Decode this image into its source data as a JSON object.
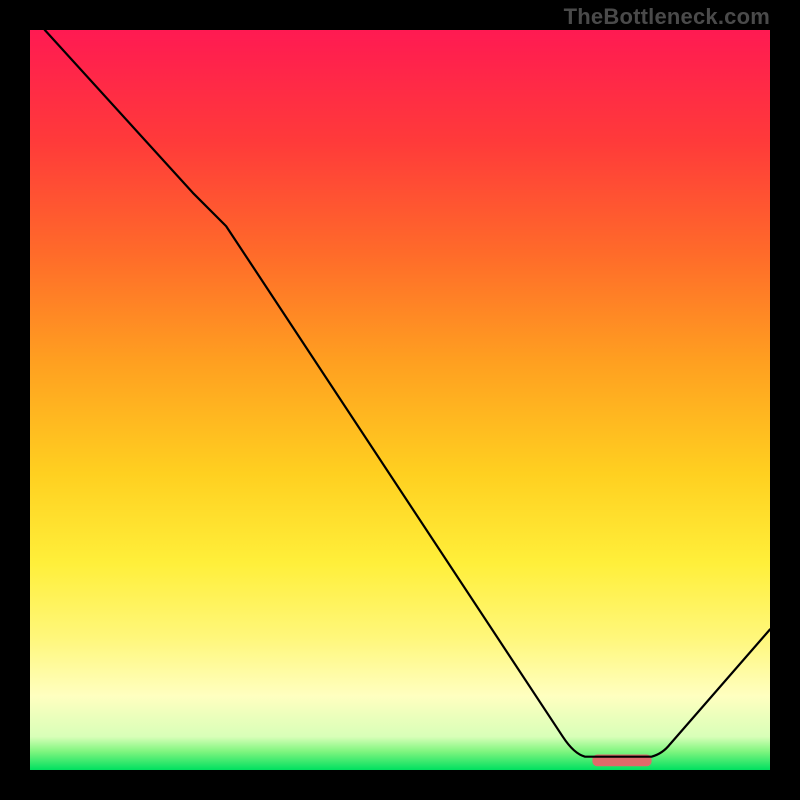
{
  "watermark": "TheBottleneck.com",
  "chart_data": {
    "type": "line",
    "title": "",
    "xlabel": "",
    "ylabel": "",
    "xlim": [
      0,
      100
    ],
    "ylim": [
      0,
      100
    ],
    "grid": false,
    "axes_visible": false,
    "gradient_bg": {
      "stops": [
        {
          "offset": 0.0,
          "color": "#ff1a52"
        },
        {
          "offset": 0.15,
          "color": "#ff3a3a"
        },
        {
          "offset": 0.3,
          "color": "#ff6a2a"
        },
        {
          "offset": 0.45,
          "color": "#ffa020"
        },
        {
          "offset": 0.6,
          "color": "#ffd020"
        },
        {
          "offset": 0.72,
          "color": "#ffef3a"
        },
        {
          "offset": 0.82,
          "color": "#fff77a"
        },
        {
          "offset": 0.9,
          "color": "#ffffc0"
        },
        {
          "offset": 0.955,
          "color": "#d8ffb8"
        },
        {
          "offset": 0.975,
          "color": "#7ff57f"
        },
        {
          "offset": 1.0,
          "color": "#00e060"
        }
      ]
    },
    "marker": {
      "x": 80,
      "y": 1.3,
      "width": 8,
      "height": 1.6,
      "color": "#e06a6a",
      "radius": 5
    },
    "series": [
      {
        "name": "curve",
        "color": "#000000",
        "width": 2.2,
        "points": [
          {
            "x": 2.0,
            "y": 100.0
          },
          {
            "x": 22.0,
            "y": 78.0,
            "mode": "L"
          },
          {
            "x": 26.5,
            "y": 73.5,
            "ctrl": {
              "cx": 25.0,
              "cy": 75.0
            }
          },
          {
            "x": 72.0,
            "y": 4.5,
            "mode": "L"
          },
          {
            "x": 75.0,
            "y": 1.8,
            "ctrl": {
              "cx": 73.5,
              "cy": 2.2
            }
          },
          {
            "x": 84.0,
            "y": 1.8,
            "mode": "L"
          },
          {
            "x": 86.5,
            "y": 3.5,
            "ctrl": {
              "cx": 85.5,
              "cy": 2.2
            }
          },
          {
            "x": 100.0,
            "y": 19.0,
            "mode": "L"
          }
        ]
      }
    ]
  }
}
